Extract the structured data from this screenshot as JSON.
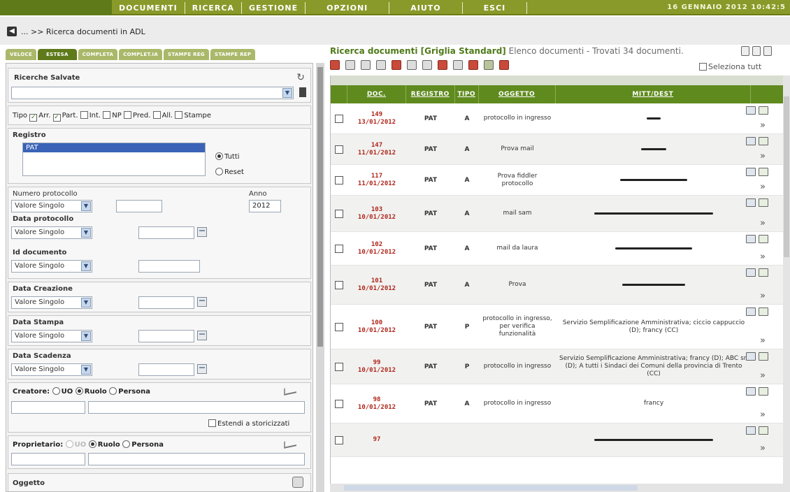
{
  "nav": {
    "items": [
      "DOCUMENTI",
      "RICERCA",
      "GESTIONE",
      "OPZIONI",
      "AIUTO",
      "ESCI"
    ],
    "datetime": "16 GENNAIO 2012 10:42:5"
  },
  "breadcrumb": {
    "text": "... >> Ricerca documenti in ADL"
  },
  "tabs": [
    "VELOCE",
    "ESTESA",
    "COMPLETA",
    "COMPLET.IA",
    "STAMPE REG",
    "STAMPE REP"
  ],
  "search": {
    "saved_title": "Ricerche Salvate",
    "tipo_label": "Tipo",
    "tipo_options": [
      "Arr.",
      "Part.",
      "Int.",
      "NP",
      "Pred.",
      "All.",
      "Stampe"
    ],
    "registro_label": "Registro",
    "registro_selected": "PAT",
    "radio_tutti": "Tutti",
    "radio_reset": "Reset",
    "numero_protocollo": "Numero protocollo",
    "anno_label": "Anno",
    "anno_value": "2012",
    "valore_singolo": "Valore Singolo",
    "data_protocollo": "Data protocollo",
    "id_documento": "Id documento",
    "data_creazione": "Data Creazione",
    "data_stampa": "Data Stampa",
    "data_scadenza": "Data Scadenza",
    "creatore_label": "Creatore:",
    "uo": "UO",
    "ruolo": "Ruolo",
    "persona": "Persona",
    "estendi": "Estendi a storicizzati",
    "proprietario_label": "Proprietario:",
    "oggetto": "Oggetto"
  },
  "results": {
    "title": "Ricerca documenti [Griglia Standard]",
    "subtitle": "Elenco documenti - Trovati 34 documenti.",
    "select_all": "Seleziona tutt",
    "headers": [
      "DOC.",
      "REGISTRO",
      "TIPO",
      "OGGETTO",
      "MITT/DEST"
    ],
    "rows": [
      {
        "num": "149",
        "date": "13/01/2012",
        "reg": "PAT",
        "tipo": "A",
        "ogg": "protocollo in ingresso",
        "mitt": ""
      },
      {
        "num": "147",
        "date": "11/01/2012",
        "reg": "PAT",
        "tipo": "A",
        "ogg": "Prova mail",
        "mitt": ""
      },
      {
        "num": "117",
        "date": "11/01/2012",
        "reg": "PAT",
        "tipo": "A",
        "ogg": "Prova fiddler protocollo",
        "mitt": ""
      },
      {
        "num": "103",
        "date": "10/01/2012",
        "reg": "PAT",
        "tipo": "A",
        "ogg": "mail sam",
        "mitt": ""
      },
      {
        "num": "102",
        "date": "10/01/2012",
        "reg": "PAT",
        "tipo": "A",
        "ogg": "mail da laura",
        "mitt": ""
      },
      {
        "num": "101",
        "date": "10/01/2012",
        "reg": "PAT",
        "tipo": "A",
        "ogg": "Prova",
        "mitt": ""
      },
      {
        "num": "100",
        "date": "10/01/2012",
        "reg": "PAT",
        "tipo": "P",
        "ogg": "protocollo in ingresso, per verifica funzionalità",
        "mitt": "Servizio Semplificazione Amministrativa; ciccio cappuccio (D); francy (CC)"
      },
      {
        "num": "99",
        "date": "10/01/2012",
        "reg": "PAT",
        "tipo": "P",
        "ogg": "protocollo in ingresso",
        "mitt": "Servizio Semplificazione Amministrativa; francy (D); ABC srl (D); A tutti i Sindaci dei Comuni della provincia di Trento (CC)"
      },
      {
        "num": "98",
        "date": "10/01/2012",
        "reg": "PAT",
        "tipo": "A",
        "ogg": "protocollo in ingresso",
        "mitt": "francy"
      },
      {
        "num": "97",
        "date": "",
        "reg": "",
        "tipo": "",
        "ogg": "",
        "mitt": ""
      }
    ]
  }
}
